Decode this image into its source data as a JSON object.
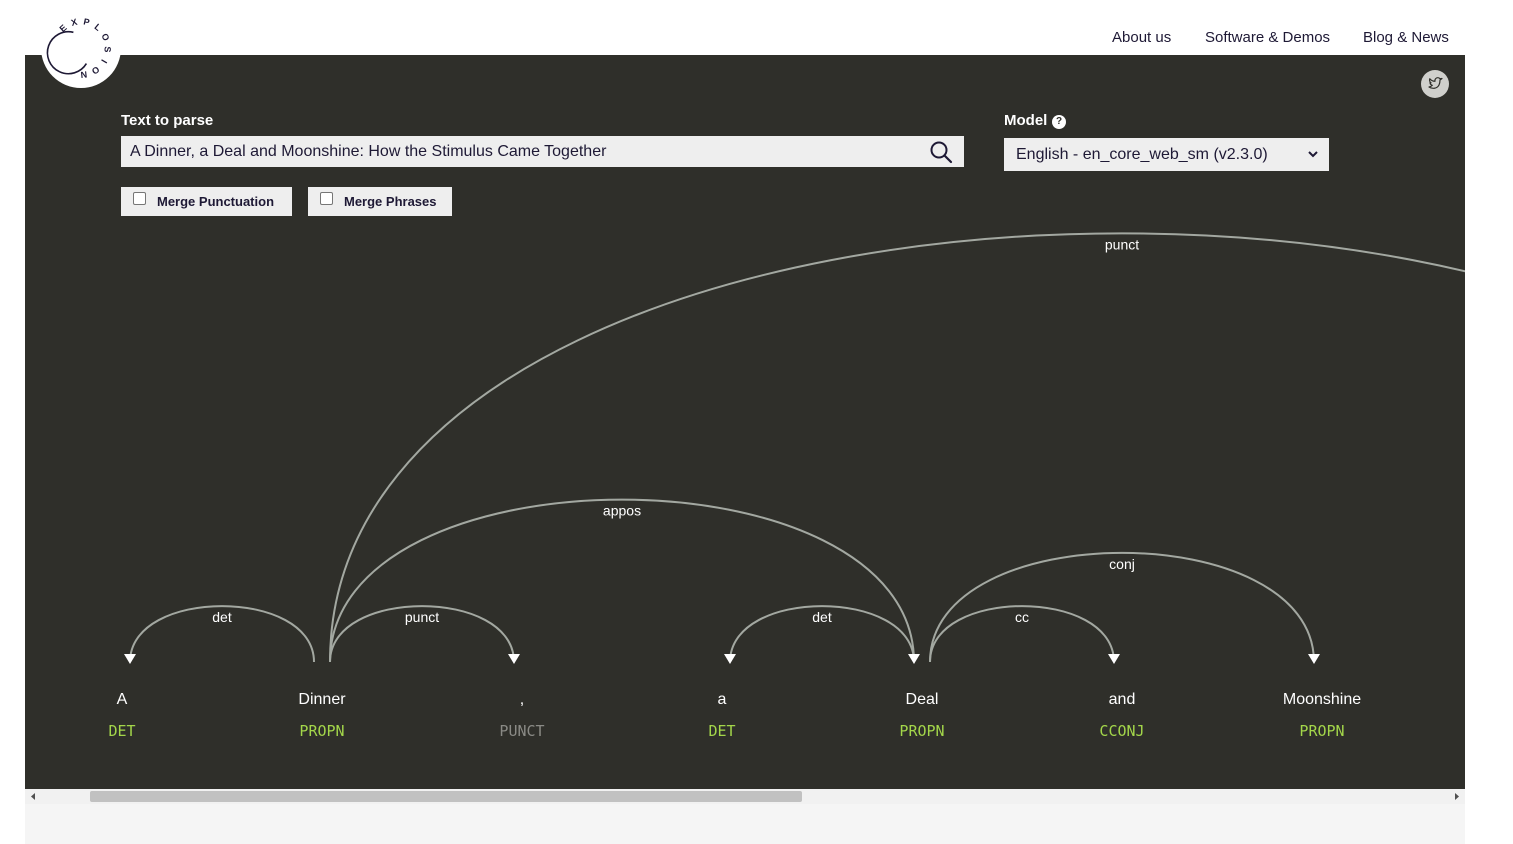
{
  "brand": {
    "logo_text": "EXPLOSION"
  },
  "nav": {
    "about": "About us",
    "software": "Software & Demos",
    "blog": "Blog & News"
  },
  "form": {
    "text_label": "Text to parse",
    "text_value": "A Dinner, a Deal and Moonshine: How the Stimulus Came Together",
    "model_label": "Model",
    "help_glyph": "?",
    "model_value": "English - en_core_web_sm (v2.3.0)",
    "merge_punct_label": "Merge Punctuation",
    "merge_punct_checked": false,
    "merge_phrases_label": "Merge Phrases",
    "merge_phrases_checked": false
  },
  "parse": {
    "words": [
      {
        "text": "A",
        "tag": "DET"
      },
      {
        "text": "Dinner",
        "tag": "PROPN"
      },
      {
        "text": ",",
        "tag": "PUNCT"
      },
      {
        "text": "a",
        "tag": "DET"
      },
      {
        "text": "Deal",
        "tag": "PROPN"
      },
      {
        "text": "and",
        "tag": "CCONJ"
      },
      {
        "text": "Moonshine",
        "tag": "PROPN"
      }
    ],
    "arcs": [
      {
        "start": 0,
        "end": 1,
        "label": "det",
        "dir": "left"
      },
      {
        "start": 1,
        "end": 2,
        "label": "punct",
        "dir": "right"
      },
      {
        "start": 3,
        "end": 4,
        "label": "det",
        "dir": "left"
      },
      {
        "start": 4,
        "end": 5,
        "label": "cc",
        "dir": "right"
      },
      {
        "start": 1,
        "end": 4,
        "label": "appos",
        "dir": "right"
      },
      {
        "start": 4,
        "end": 6,
        "label": "conj",
        "dir": "right"
      },
      {
        "start": 1,
        "end": 9,
        "label": "punct",
        "dir": "right"
      }
    ]
  },
  "colors": {
    "stage_bg": "#2f2f2a",
    "arc": "#a3a8a1",
    "word": "#ffffff",
    "tag": "#a3d64a",
    "tag_punct": "#8a8a85"
  }
}
